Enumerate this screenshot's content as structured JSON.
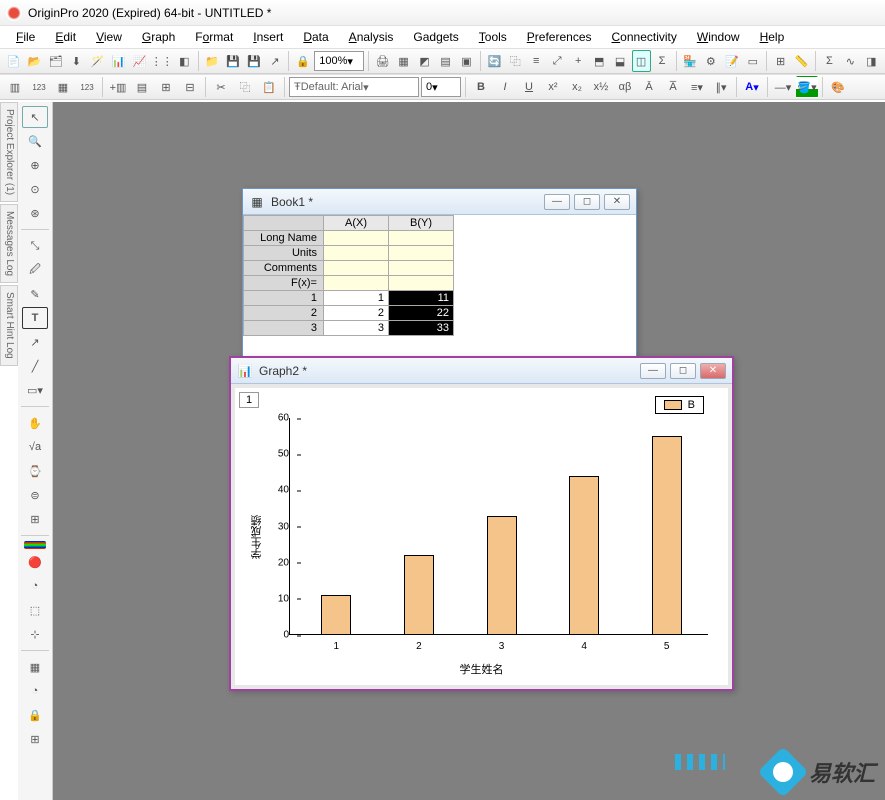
{
  "app_title": "OriginPro 2020 (Expired) 64-bit - UNTITLED *",
  "menu": [
    "File",
    "Edit",
    "View",
    "Graph",
    "Format",
    "Insert",
    "Data",
    "Analysis",
    "Gadgets",
    "Tools",
    "Preferences",
    "Connectivity",
    "Window",
    "Help"
  ],
  "zoom": "100%",
  "font": "Default: Arial",
  "fontsize": "0",
  "side_tabs": [
    "Project Explorer (1)",
    "Messages Log",
    "Smart Hint Log"
  ],
  "book": {
    "title": "Book1 *",
    "columns": [
      "A(X)",
      "B(Y)"
    ],
    "meta_rows": [
      "Long Name",
      "Units",
      "Comments",
      "F(x)="
    ],
    "rows": [
      {
        "n": "1",
        "a": "1",
        "b": "11"
      },
      {
        "n": "2",
        "a": "2",
        "b": "22"
      },
      {
        "n": "3",
        "a": "3",
        "b": "33"
      }
    ]
  },
  "graph": {
    "title": "Graph2 *",
    "page": "1",
    "legend": "B",
    "ylabel": "学生成绩",
    "xlabel": "学生姓名"
  },
  "chart_data": {
    "type": "bar",
    "categories": [
      "1",
      "2",
      "3",
      "4",
      "5"
    ],
    "values": [
      11,
      22,
      33,
      44,
      55
    ],
    "series_name": "B",
    "ylabel": "学生成绩",
    "xlabel": "学生姓名",
    "ylim": [
      0,
      60
    ],
    "yticks": [
      0,
      10,
      20,
      30,
      40,
      50,
      60
    ]
  },
  "watermark": "易软汇"
}
